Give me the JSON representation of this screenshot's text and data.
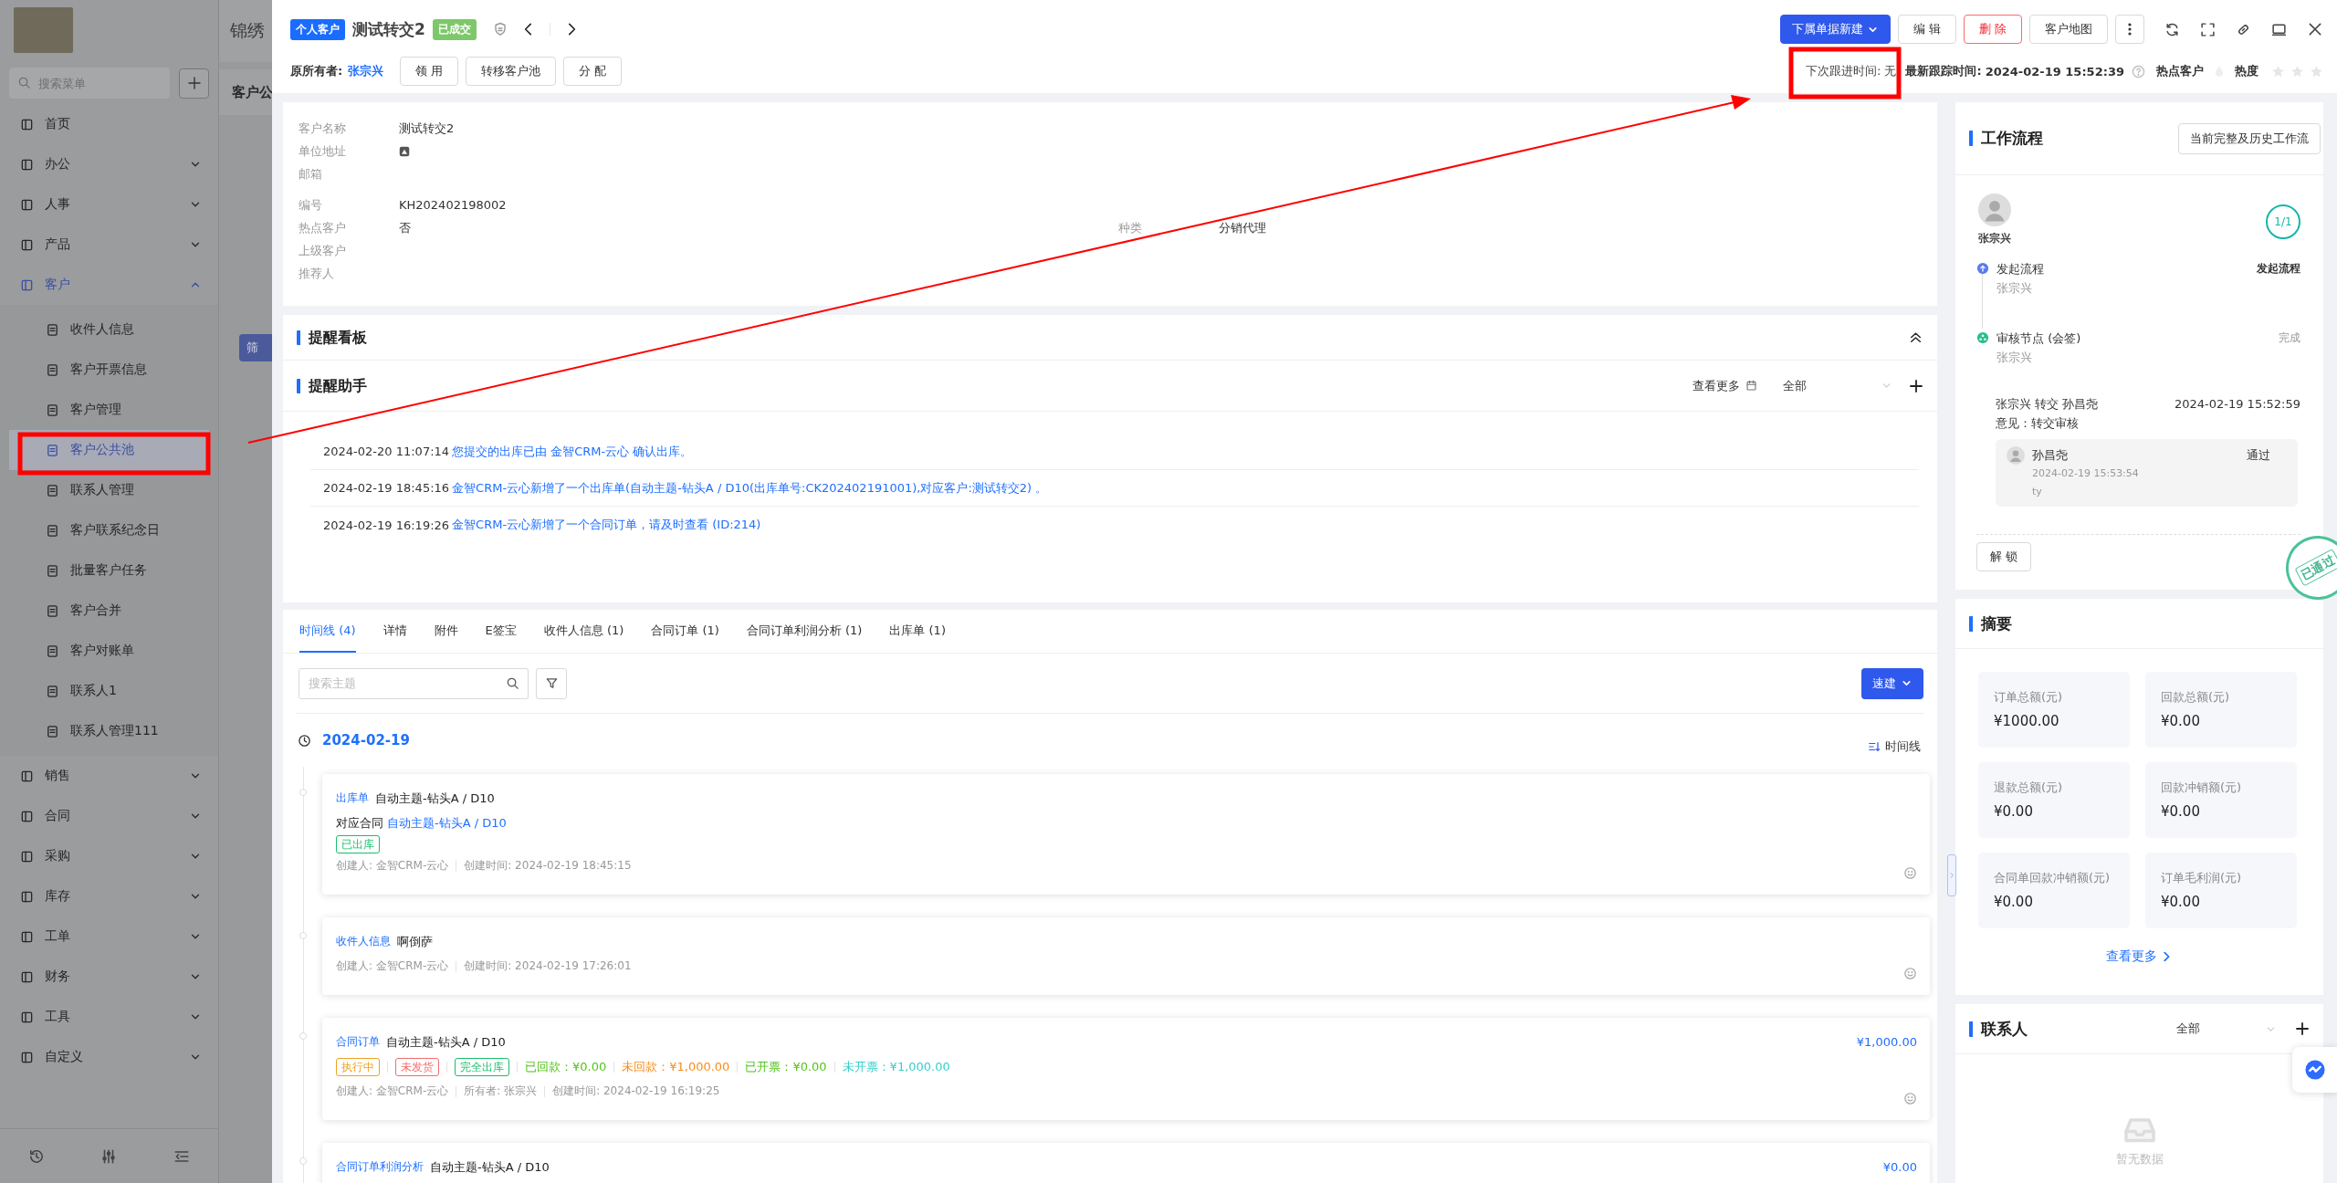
{
  "sidebar": {
    "search_placeholder": "搜索菜单",
    "items": [
      {
        "label": "首页",
        "kind": "link"
      },
      {
        "label": "办公",
        "kind": "group",
        "expanded": false
      },
      {
        "label": "人事",
        "kind": "group",
        "expanded": false
      },
      {
        "label": "产品",
        "kind": "group",
        "expanded": false
      },
      {
        "label": "客户",
        "kind": "group",
        "expanded": true,
        "children": [
          {
            "label": "收件人信息",
            "selected": false
          },
          {
            "label": "客户开票信息",
            "selected": false
          },
          {
            "label": "客户管理",
            "selected": false
          },
          {
            "label": "客户公共池",
            "selected": true
          },
          {
            "label": "联系人管理",
            "selected": false
          },
          {
            "label": "客户联系纪念日",
            "selected": false
          },
          {
            "label": "批量客户任务",
            "selected": false
          },
          {
            "label": "客户合并",
            "selected": false
          },
          {
            "label": "客户对账单",
            "selected": false
          },
          {
            "label": "联系人1",
            "selected": false
          },
          {
            "label": "联系人管理111",
            "selected": false
          }
        ]
      },
      {
        "label": "销售",
        "kind": "group",
        "expanded": false
      },
      {
        "label": "合同",
        "kind": "group",
        "expanded": false
      },
      {
        "label": "采购",
        "kind": "group",
        "expanded": false
      },
      {
        "label": "库存",
        "kind": "group",
        "expanded": false
      },
      {
        "label": "工单",
        "kind": "group",
        "expanded": false
      },
      {
        "label": "财务",
        "kind": "group",
        "expanded": false
      },
      {
        "label": "工具",
        "kind": "group",
        "expanded": false
      },
      {
        "label": "自定义",
        "kind": "group",
        "expanded": false
      }
    ]
  },
  "background_page": {
    "title": "锦绣",
    "tab": "客户公",
    "filter_button": "筛"
  },
  "header": {
    "type_tag": "个人客户",
    "title": "测试转交2",
    "status_tag": "已成交",
    "owner_label": "原所有者:",
    "owner": "张宗兴",
    "actions": [
      "领 用",
      "转移客户池",
      "分 配"
    ],
    "primary_button": "下属单据新建",
    "buttons": [
      {
        "label": "编 辑",
        "kind": "default"
      },
      {
        "label": "删 除",
        "kind": "danger"
      },
      {
        "label": "客户地图",
        "kind": "default"
      }
    ],
    "next_follow_label": "下次跟进时间:",
    "next_follow": "无",
    "last_track_label": "最新跟踪时间:",
    "last_track": "2024-02-19 15:52:39",
    "hot_label": "热点客户",
    "heat_label": "热度",
    "stars": 0
  },
  "info": {
    "basic_fields": [
      {
        "label": "客户名称",
        "value": "测试转交2",
        "kind": "text"
      },
      {
        "label": "单位地址",
        "kind": "address"
      },
      {
        "label": "邮箱",
        "kind": "text"
      }
    ],
    "other_fields": [
      {
        "label": "编号",
        "value": "KH202402198002"
      },
      {
        "label": "热点客户",
        "value": "否",
        "extra": {
          "label": "种类",
          "value": "分销代理"
        }
      },
      {
        "label": "上级客户"
      },
      {
        "label": "推荐人"
      }
    ]
  },
  "reminders": {
    "board_title": "提醒看板",
    "assistant_title": "提醒助手",
    "more": "查看更多",
    "filter": "全部",
    "items": [
      {
        "time": "2024-02-20 11:07:14",
        "text": "您提交的出库已由 金智CRM-云心 确认出库。"
      },
      {
        "time": "2024-02-19 18:45:16",
        "text": "金智CRM-云心新增了一个出库单(自动主题-钻头A / D10(出库单号:CK202402191001),对应客户:测试转交2) 。"
      },
      {
        "time": "2024-02-19 16:19:26",
        "text": "金智CRM-云心新增了一个合同订单，请及时查看 (ID:214)"
      }
    ]
  },
  "records": {
    "tabs": [
      {
        "label": "时间线 (4)",
        "selected": true
      },
      {
        "label": "详情",
        "selected": false
      },
      {
        "label": "附件",
        "selected": false
      },
      {
        "label": "E签宝",
        "selected": false
      },
      {
        "label": "收件人信息 (1)",
        "selected": false
      },
      {
        "label": "合同订单 (1)",
        "selected": false
      },
      {
        "label": "合同订单利润分析 (1)",
        "selected": false
      },
      {
        "label": "出库单 (1)",
        "selected": false
      }
    ],
    "search_placeholder": "搜索主题",
    "quick_button": "速建",
    "date": "2024-02-19",
    "view_toggle": "时间线",
    "entries": [
      {
        "type": "出库单",
        "title": "自动主题-钻头A / D10",
        "link_label": "对应合同",
        "link": "自动主题-钻头A / D10",
        "tags": [
          {
            "label": "已出库",
            "color": "#19be6b"
          }
        ],
        "meta": [
          "创建人: 金智CRM-云心",
          "创建时间: 2024-02-19 18:45:15"
        ]
      },
      {
        "type": "收件人信息",
        "title": "啊倒萨",
        "meta": [
          "创建人: 金智CRM-云心",
          "创建时间: 2024-02-19 17:26:01"
        ]
      },
      {
        "type": "合同订单",
        "title": "自动主题-钻头A / D10",
        "amount": "¥1,000.00",
        "tags": [
          {
            "label": "执行中",
            "color": "#f0a020"
          },
          {
            "label": "未发货",
            "color": "#f56c6c"
          },
          {
            "label": "完全出库",
            "color": "#19be6b"
          }
        ],
        "figures": [
          {
            "text": "已回款：¥0.00",
            "color": "#52c41a"
          },
          {
            "text": "未回款：¥1,000.00",
            "color": "#fa8c16"
          },
          {
            "text": "已开票：¥0.00",
            "color": "#52c41a"
          },
          {
            "text": "未开票：¥1,000.00",
            "color": "#36cfc9"
          }
        ],
        "meta": [
          "创建人: 金智CRM-云心",
          "所有者: 张宗兴",
          "创建时间: 2024-02-19 16:19:25"
        ]
      },
      {
        "type": "合同订单利润分析",
        "title": "自动主题-钻头A / D10",
        "amount": "¥0.00"
      }
    ]
  },
  "workflow": {
    "title": "工作流程",
    "history_button": "当前完整及历史工作流",
    "initiator": "张宗兴",
    "progress": "1/1",
    "steps": [
      {
        "kind": "start",
        "title": "发起流程",
        "person": "张宗兴",
        "status": "发起流程"
      },
      {
        "kind": "review",
        "title": "审核节点 (会签)",
        "person": "张宗兴",
        "status": "完成"
      }
    ],
    "transfer": "张宗兴 转交 孙昌尧",
    "transfer_time": "2024-02-19 15:52:59",
    "opinion": "意见：转交审核",
    "approval": {
      "name": "孙昌尧",
      "result": "通过",
      "time": "2024-02-19 15:53:54",
      "comment": "ty"
    },
    "stamp": "已通过",
    "unlock_button": "解 锁"
  },
  "summary": {
    "title": "摘要",
    "items": [
      {
        "label": "订单总额(元)",
        "value": "¥1000.00"
      },
      {
        "label": "回款总额(元)",
        "value": "¥0.00"
      },
      {
        "label": "退款总额(元)",
        "value": "¥0.00"
      },
      {
        "label": "回款冲销额(元)",
        "value": "¥0.00"
      },
      {
        "label": "合同单回款冲销额(元)",
        "value": "¥0.00"
      },
      {
        "label": "订单毛利润(元)",
        "value": "¥0.00"
      }
    ],
    "more": "查看更多"
  },
  "contacts": {
    "title": "联系人",
    "filter": "全部",
    "empty_text": "暂无数据"
  }
}
